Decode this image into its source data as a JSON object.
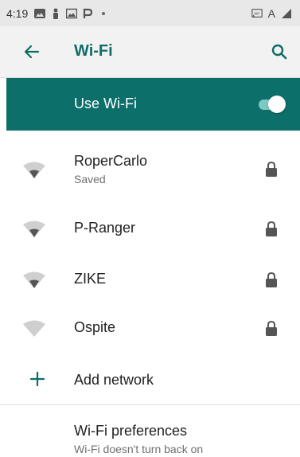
{
  "status_bar": {
    "time": "4:19",
    "right_text": "A",
    "icons_left": [
      "gallery-icon",
      "person-icon",
      "image-icon",
      "p-icon",
      "dot-icon"
    ],
    "icons_right": [
      "cast-icon",
      "a-icon",
      "signal-icon"
    ]
  },
  "app_bar": {
    "title": "Wi-Fi",
    "back_icon": "arrow-back-icon",
    "search_icon": "search-icon"
  },
  "master_switch": {
    "label": "Use Wi-Fi",
    "enabled": true
  },
  "networks": [
    {
      "name": "RoperCarlo",
      "status": "Saved",
      "secured": true
    },
    {
      "name": "P-Ranger",
      "secured": true
    },
    {
      "name": "ZIKE",
      "secured": true
    },
    {
      "name": "Ospite",
      "secured": true
    }
  ],
  "add_network": {
    "label": "Add network"
  },
  "preferences": {
    "title": "Wi-Fi preferences",
    "summary": "Wi-Fi doesn't turn back on"
  },
  "colors": {
    "accent": "#0c6f6a",
    "title": "#0f6d66",
    "status_bar_bg": "#e8e8e8"
  }
}
